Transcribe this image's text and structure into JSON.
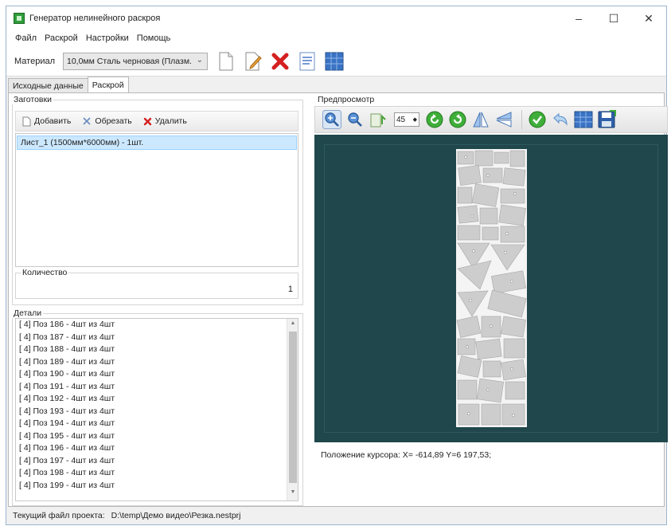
{
  "window": {
    "title": "Генератор нелинейного раскроя",
    "minimize": "–",
    "maximize": "☐",
    "close": "✕"
  },
  "menu": [
    "Файл",
    "Раскрой",
    "Настройки",
    "Помощь"
  ],
  "toolbar": {
    "material_label": "Материал",
    "material_value": "10,0мм Сталь черновая (Плазм.",
    "buttons": [
      "new-file-icon",
      "edit-icon",
      "delete-icon",
      "list-icon",
      "grid-icon"
    ]
  },
  "tabs": [
    {
      "label": "Исходные данные",
      "active": false
    },
    {
      "label": "Раскрой",
      "active": true
    }
  ],
  "blanks": {
    "title": "Заготовки",
    "add": "Добавить",
    "trim": "Обрезать",
    "remove": "Удалить",
    "items": [
      "Лист_1 (1500мм*6000мм) - 1шт."
    ]
  },
  "quantity": {
    "label": "Количество",
    "value": "1"
  },
  "details": {
    "title": "Детали",
    "items": [
      "[  4] Поз 186 - 4шт из 4шт",
      "[  4] Поз 187 - 4шт из 4шт",
      "[  4] Поз 188 - 4шт из 4шт",
      "[  4] Поз 189 - 4шт из 4шт",
      "[  4] Поз 190 - 4шт из 4шт",
      "[  4] Поз 191 - 4шт из 4шт",
      "[  4] Поз 192 - 4шт из 4шт",
      "[  4] Поз 193 - 4шт из 4шт",
      "[  4] Поз 194 - 4шт из 4шт",
      "[  4] Поз 195 - 4шт из 4шт",
      "[  4] Поз 196 - 4шт из 4шт",
      "[  4] Поз 197 - 4шт из 4шт",
      "[  4] Поз 198 - 4шт из 4шт",
      "[  4] Поз 199 - 4шт из 4шт"
    ]
  },
  "preview": {
    "title": "Предпросмотр",
    "angle": "45",
    "cursor": "Положение курсора: X= -614,89 Y=6 197,53;",
    "bg_color": "#20474b"
  },
  "status": {
    "label": "Текущий файл проекта:",
    "path": "D:\\temp\\Демо видео\\Резка.nestprj"
  }
}
